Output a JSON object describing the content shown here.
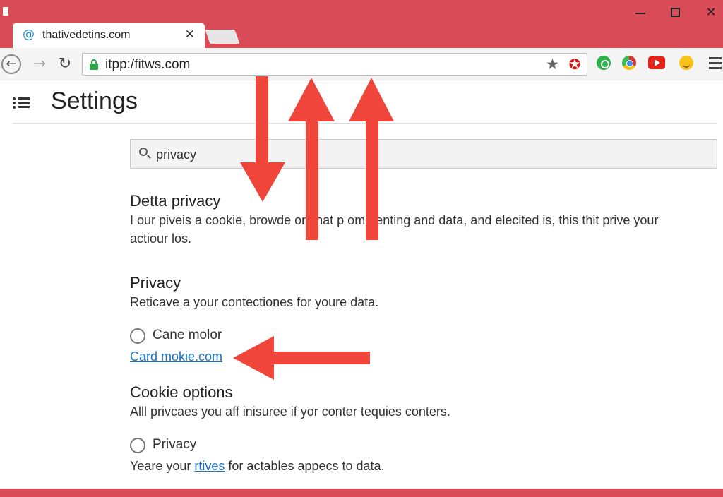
{
  "browser": {
    "tab_title": "thativedetins.com",
    "tab_favicon": "at-sign-icon",
    "url": "itpp:/fitws.com",
    "colors": {
      "chrome_accent": "#d94c57",
      "toolbar": "#f4f4f4",
      "secure_lock": "#2ea84a",
      "annotation_arrow": "#f0453a"
    },
    "extensions": [
      "whatsapp-icon",
      "chrome-icon",
      "youtube-icon",
      "emoji-icon"
    ]
  },
  "settings": {
    "title": "Settings",
    "search": {
      "value": "privacy"
    },
    "sections": [
      {
        "title": "Detta privacy",
        "text_line1": "I our piveis a cookie, browde on that p ome enting and data, and elecited is, this thit prive your",
        "text_line2": "actiour los."
      },
      {
        "title": "Privacy",
        "text": "Reticave a your contectiones for youre data.",
        "option_label": "Cane molor",
        "link": "Card mokie.com"
      },
      {
        "title": "Cookie options",
        "text": "Alll privcaes you aff inisuree if yor conter tequies conters.",
        "option_label": "Privacy",
        "footer_before": "Yeare your ",
        "footer_link": "rtives",
        "footer_after": " for actables appecs to data."
      }
    ]
  }
}
